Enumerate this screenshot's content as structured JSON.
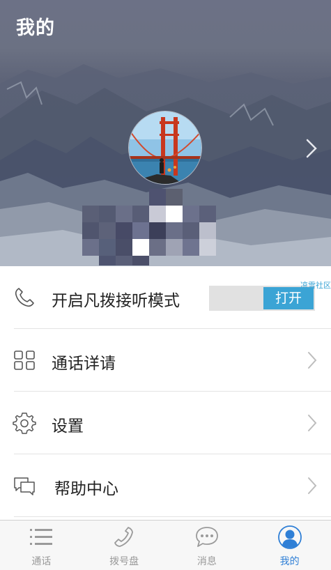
{
  "header": {
    "title": "我的"
  },
  "menu": {
    "items": [
      {
        "label": "开启凡拨接听模式",
        "icon": "phone-handset-icon",
        "control": "toggle",
        "toggle_label": "打开",
        "toggle_tag": "凉雪社区"
      },
      {
        "label": "通话详请",
        "icon": "grid-icon",
        "control": "chevron"
      },
      {
        "label": "设置",
        "icon": "gear-icon",
        "control": "chevron"
      },
      {
        "label": "帮助中心",
        "icon": "chat-bubbles-icon",
        "control": "chevron"
      }
    ]
  },
  "tabbar": {
    "tabs": [
      {
        "label": "通话",
        "icon": "list-icon",
        "active": false
      },
      {
        "label": "拨号盘",
        "icon": "phone-icon",
        "active": false
      },
      {
        "label": "消息",
        "icon": "message-icon",
        "active": false
      },
      {
        "label": "我的",
        "icon": "user-icon",
        "active": true
      }
    ]
  },
  "colors": {
    "accent": "#3ba4d5",
    "tab_active": "#2f7fd6",
    "tab_inactive": "#9a9a9a"
  }
}
